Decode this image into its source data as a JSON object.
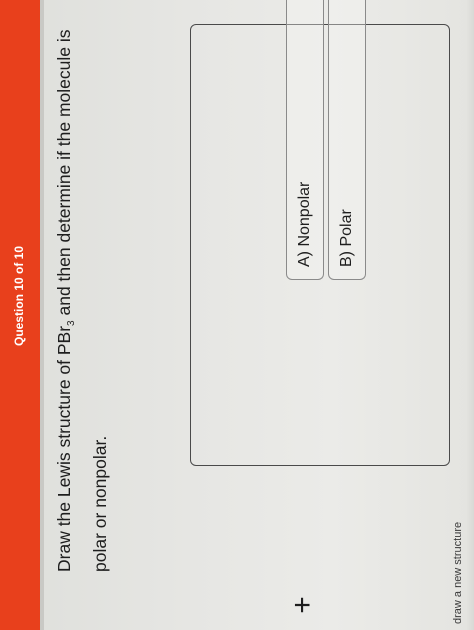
{
  "header": {
    "question_counter": "Question 10 of 10",
    "accent_color": "#e8401c"
  },
  "question": {
    "text_before": "Draw the Lewis structure of PBr",
    "subscript": "3",
    "text_after": " and then determine if the molecule is polar or nonpolar."
  },
  "drawing": {
    "add_icon": "plus-icon",
    "label": "draw a new structure"
  },
  "choices": [
    {
      "label": "A) Nonpolar"
    },
    {
      "label": "B) Polar"
    }
  ]
}
